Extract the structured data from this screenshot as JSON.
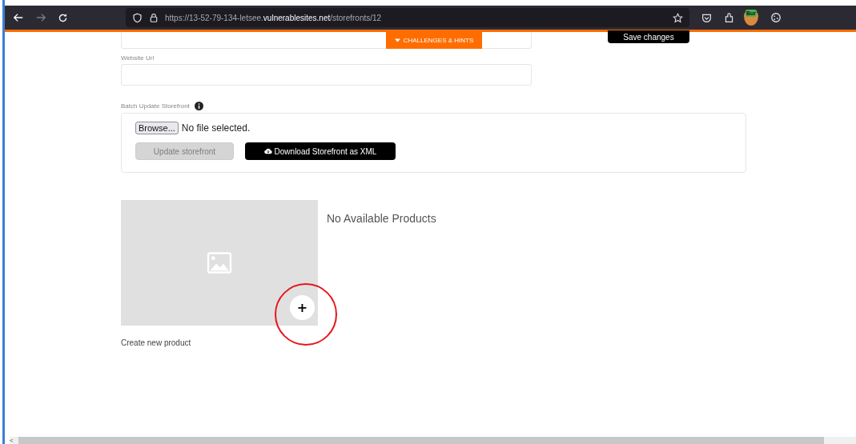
{
  "browser": {
    "url": "https://13-52-79-134-letsee.**vulnerablesites.net**/storefronts/12",
    "extension_badge": "Bur",
    "back_enabled": true,
    "forward_enabled": false
  },
  "challenges_tab": {
    "label": "CHALLENGES & HINTS"
  },
  "save_button": {
    "label": "Save changes"
  },
  "website_url": {
    "label": "Website Url"
  },
  "batch_update": {
    "label": "Batch Update Storefront",
    "browse_label": "Browse...",
    "file_status": "No file selected.",
    "update_button": {
      "label": "Update storefront",
      "disabled": true
    },
    "download_button": {
      "label": "Download Storefront as XML"
    }
  },
  "products": {
    "empty_message": "No Available Products",
    "create_label": "Create new product",
    "add_symbol": "+"
  },
  "scrollbar_arrow": "<"
}
